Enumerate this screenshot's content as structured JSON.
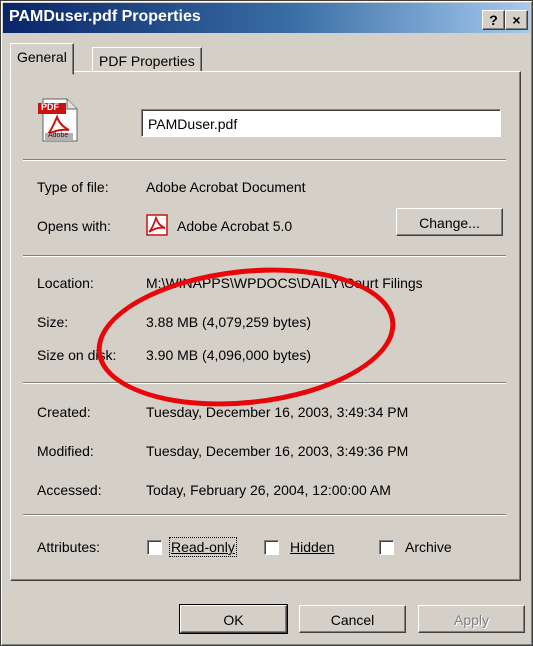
{
  "window": {
    "title": "PAMDuser.pdf Properties",
    "help_button": "?",
    "close_button": "×"
  },
  "tabs": [
    {
      "label": "General",
      "active": true
    },
    {
      "label": "PDF Properties",
      "active": false
    }
  ],
  "general": {
    "file_icon": "adobe-pdf-file-icon",
    "file_icon_caption": "PDF",
    "file_icon_brand": "Adobe",
    "filename": "PAMDuser.pdf",
    "type_label": "Type of file:",
    "type_value": "Adobe Acrobat Document",
    "opens_label": "Opens with:",
    "opens_value": "Adobe Acrobat 5.0",
    "change_button": "Change...",
    "location_label": "Location:",
    "location_value": "M:\\WINAPPS\\WPDOCS\\DAILY\\Court Filings",
    "size_label": "Size:",
    "size_value": "3.88 MB (4,079,259 bytes)",
    "size_on_disk_label": "Size on disk:",
    "size_on_disk_value": "3.90 MB (4,096,000 bytes)",
    "created_label": "Created:",
    "created_value": "Tuesday, December 16, 2003, 3:49:34 PM",
    "modified_label": "Modified:",
    "modified_value": "Tuesday, December 16, 2003, 3:49:36 PM",
    "accessed_label": "Accessed:",
    "accessed_value": "Today, February 26, 2004, 12:00:00 AM",
    "attributes_label": "Attributes:",
    "attributes": [
      {
        "label": "Read-only",
        "checked": false
      },
      {
        "label": "Hidden",
        "checked": false
      },
      {
        "label": "Archive",
        "checked": false
      }
    ]
  },
  "footer": {
    "ok": "OK",
    "cancel": "Cancel",
    "apply": "Apply"
  },
  "colors": {
    "dialog_bg": "#d4d0c8",
    "title_gradient_start": "#0a246a",
    "title_gradient_end": "#a6caf0",
    "annotation_oval": "#e8060a"
  }
}
